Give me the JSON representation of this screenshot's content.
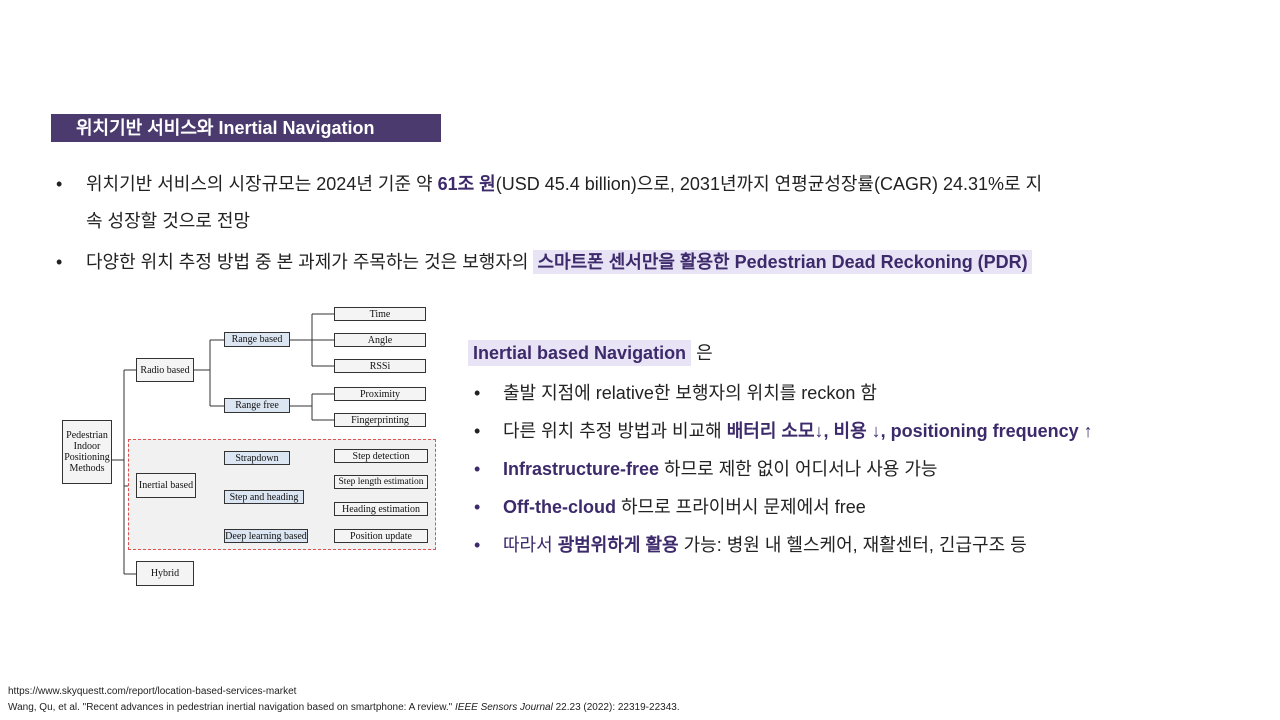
{
  "title": "위치기반 서비스와 Inertial Navigation",
  "bullets": [
    {
      "pre": "위치기반 서비스의 시장규모는 2024년 기준 약 ",
      "bold": "61조 원",
      "post": "(USD 45.4 billion)으로, 2031년까지 연평균성장률(CAGR)  24.31%로 지",
      "cont": "속 성장할 것으로 전망"
    },
    {
      "pre": "다양한 위치 추정 방법 중 본 과제가 주목하는 것은 보행자의 ",
      "hl": "스마트폰 센서만을 활용한 Pedestrian Dead Reckoning (PDR)"
    }
  ],
  "diagram": {
    "root": "Pedestrian Indoor Positioning Methods",
    "level1": [
      "Radio based",
      "Inertial based",
      "Hybrid"
    ],
    "radio_children": [
      "Range based",
      "Range free"
    ],
    "range_based_children": [
      "Time",
      "Angle",
      "RSSi"
    ],
    "range_free_children": [
      "Proximity",
      "Fingerprinting"
    ],
    "inertial_children": [
      "Strapdown",
      "Step and heading",
      "Deep learning based"
    ],
    "inertial_leaves": [
      "Step detection",
      "Step length estimation",
      "Heading estimation",
      "Position update"
    ]
  },
  "right": {
    "head_hl": "Inertial based Navigation",
    "head_post": " 은",
    "items": [
      {
        "text": "출발 지점에 relative한 보행자의 위치를 reckon 함"
      },
      {
        "pre": "다른 위치 추정 방법과 비교해 ",
        "bold": "배터리 소모↓, 비용 ↓, positioning frequency ↑"
      },
      {
        "bold": "Infrastructure-free",
        "post": " 하므로 제한 없이 어디서나 사용 가능"
      },
      {
        "bold": "Off-the-cloud",
        "post": " 하므로 프라이버시 문제에서 free"
      },
      {
        "pre": "따라서 ",
        "bold": "광범위하게 활용",
        "post": " 가능: 병원 내 헬스케어, 재활센터, 긴급구조 등"
      }
    ]
  },
  "refs": {
    "line1": "https://www.skyquestt.com/report/location-based-services-market",
    "line2_pre": "Wang, Qu, et al. \"Recent advances in pedestrian inertial navigation based on smartphone: A review.\" ",
    "line2_journal": "IEEE Sensors Journal",
    "line2_post": " 22.23 (2022): 22319-22343."
  },
  "colors": {
    "title_bg": "#4a3a6e",
    "accent": "#3d2a6b",
    "highlight": "#e9e4f5",
    "dashed_border": "#e05050",
    "node_blue": "#dce6f2"
  },
  "bullet_symbol": "•"
}
